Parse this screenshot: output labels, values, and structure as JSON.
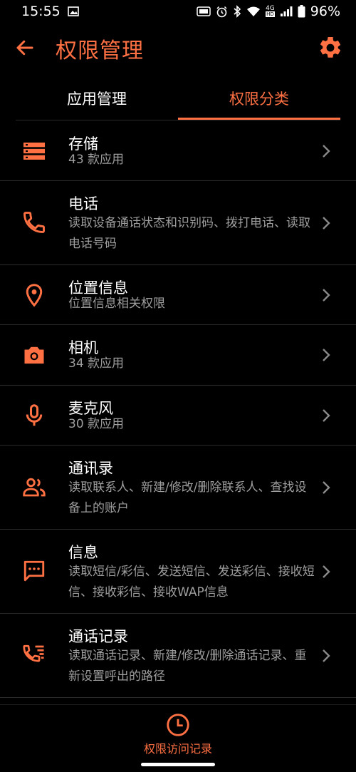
{
  "status_bar": {
    "time": "15:55",
    "network_badge": "4G",
    "network_sub": "HD",
    "battery": "96%"
  },
  "app_bar": {
    "title": "权限管理",
    "back_icon": "arrow-left-icon",
    "settings_icon": "gear-icon"
  },
  "tabs": [
    {
      "label": "应用管理",
      "active": false
    },
    {
      "label": "权限分类",
      "active": true
    }
  ],
  "permissions": [
    {
      "title": "存储",
      "subtitle": "43 款应用",
      "icon": "storage-icon"
    },
    {
      "title": "电话",
      "subtitle": "读取设备通话状态和识别码、拨打电话、读取电话号码",
      "icon": "phone-icon"
    },
    {
      "title": "位置信息",
      "subtitle": "位置信息相关权限",
      "icon": "location-pin-icon"
    },
    {
      "title": "相机",
      "subtitle": "34 款应用",
      "icon": "camera-icon"
    },
    {
      "title": "麦克风",
      "subtitle": "30 款应用",
      "icon": "microphone-icon"
    },
    {
      "title": "通讯录",
      "subtitle": "读取联系人、新建/修改/删除联系人、查找设备上的账户",
      "icon": "contacts-icon"
    },
    {
      "title": "信息",
      "subtitle": "读取短信/彩信、发送短信、发送彩信、接收短信、接收彩信、接收WAP信息",
      "icon": "message-icon"
    },
    {
      "title": "通话记录",
      "subtitle": "读取通话记录、新建/修改/删除通话记录、重新设置呼出的路径",
      "icon": "call-log-icon"
    }
  ],
  "bottom_nav": {
    "label": "权限访问记录",
    "icon": "clock-icon"
  },
  "colors": {
    "accent": "#ff7043",
    "background": "#000000",
    "subtitle": "#9e9e9e"
  }
}
